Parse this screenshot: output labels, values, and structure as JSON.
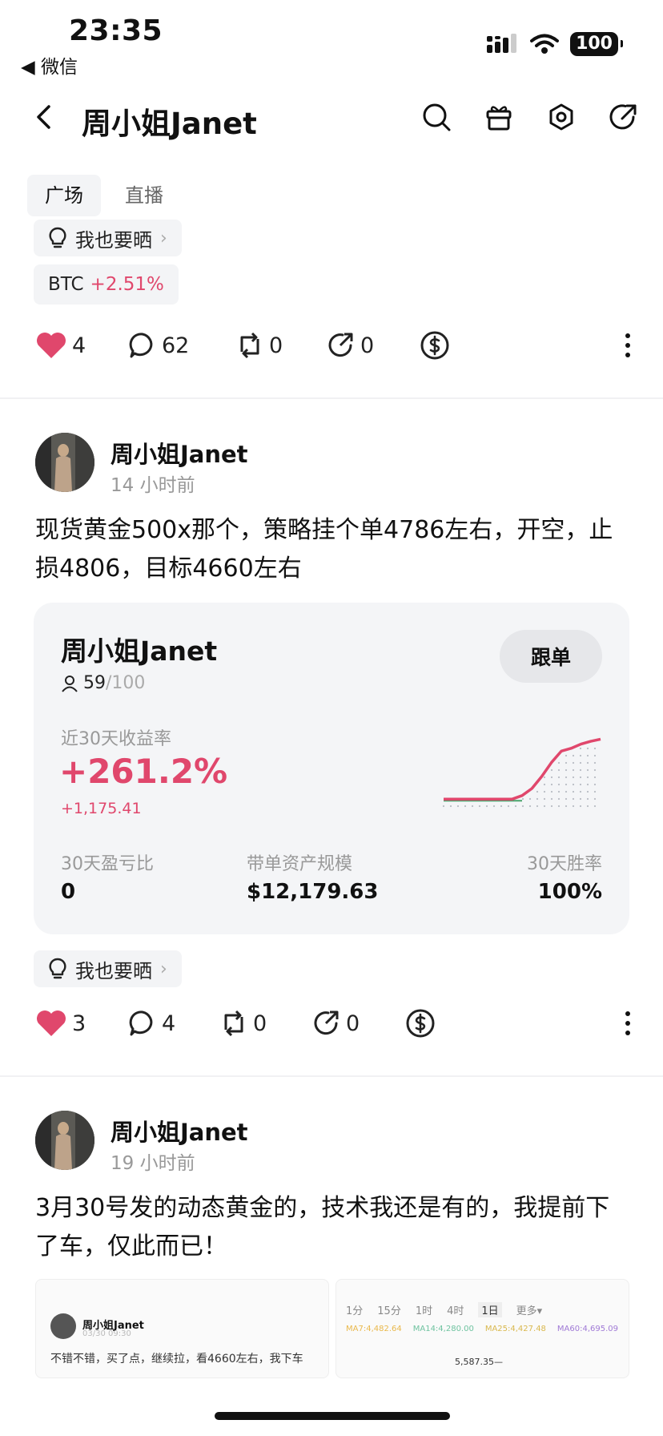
{
  "status": {
    "time": "23:35",
    "back_app": "◀ 微信",
    "battery": "100"
  },
  "nav": {
    "title": "周小姐Janet"
  },
  "tabs": [
    {
      "label": "广场"
    },
    {
      "label": "直播"
    }
  ],
  "colors": {
    "accent_red": "#e0476c",
    "chip_bg": "#f3f4f6",
    "card_bg": "#f4f5f7"
  },
  "post1": {
    "share_chip": "我也要晒",
    "ticker": {
      "symbol": "BTC",
      "change": "+2.51%"
    },
    "actions": {
      "likes": "4",
      "comments": "62",
      "reposts": "0",
      "shares": "0"
    }
  },
  "post2": {
    "author": "周小姐Janet",
    "time": "14 小时前",
    "text": "现货黄金500x那个，策略挂个单4786左右，开空，止损4806，目标4660左右",
    "card": {
      "name": "周小姐Janet",
      "followers": "59",
      "followers_max": "/100",
      "follow_btn": "跟单",
      "return_label": "近30天收益率",
      "return_pct": "+261.2%",
      "return_abs": "+1,175.41",
      "stats": [
        {
          "label": "30天盈亏比",
          "value": "0"
        },
        {
          "label": "带单资产规模",
          "value": "$12,179.63"
        },
        {
          "label": "30天胜率",
          "value": "100%"
        }
      ],
      "sparkline": [
        0.1,
        0.1,
        0.1,
        0.1,
        0.1,
        0.1,
        0.1,
        0.1,
        0.15,
        0.25,
        0.42,
        0.62,
        0.78,
        0.82,
        0.88,
        0.92,
        0.95
      ]
    },
    "share_chip": "我也要晒",
    "actions": {
      "likes": "3",
      "comments": "4",
      "reposts": "0",
      "shares": "0"
    }
  },
  "post3": {
    "author": "周小姐Janet",
    "time": "19 小时前",
    "text": "3月30号发的动态黄金的，技术我还是有的，我提前下了车，仅此而已！",
    "thumb1": {
      "author": "周小姐Janet",
      "time": "03/30 09:30",
      "text": "不错不错，买了点，继续拉，看4660左右，我下车"
    },
    "thumb2": {
      "timeframes": [
        "1分",
        "15分",
        "1时",
        "4时",
        "1日",
        "更多▾"
      ],
      "selected": "1日",
      "price_tag": "5,587.35—",
      "ma_labels": [
        "MA7:4,482.64",
        "MA14:4,280.00",
        "MA25:4,427.48",
        "MA60:4,695.09"
      ]
    }
  }
}
